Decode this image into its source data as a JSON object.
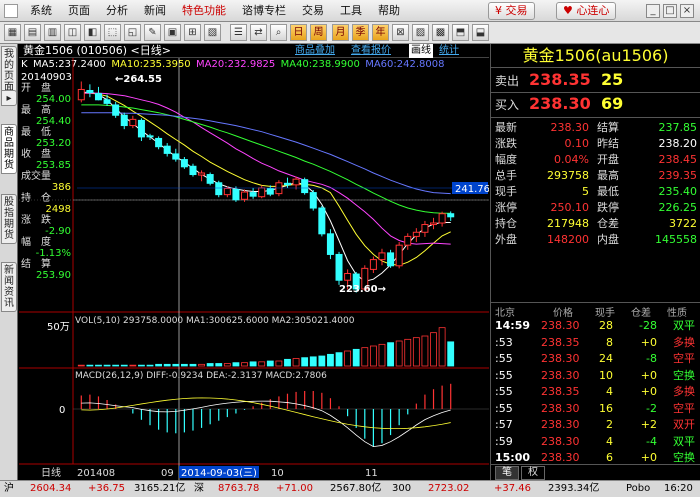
{
  "menu": {
    "items": [
      "系统",
      "页面",
      "分析",
      "新闻",
      "特色功能",
      "谘博专栏",
      "交易",
      "工具",
      "帮助"
    ],
    "active_index": 4,
    "trade_label": "交易",
    "connect_label": "心连心"
  },
  "toolbar": {
    "buttons": [
      "日",
      "周",
      "月",
      "季",
      "年"
    ]
  },
  "left_tabs": [
    "我的页面",
    "商品期货",
    "股指期货",
    "新闻资讯"
  ],
  "chart": {
    "title": "黄金1506 (010506) <日线>",
    "buttons": [
      "商品叠加",
      "查看报价",
      "画线",
      "统计"
    ],
    "ma_prefix": "K",
    "ma": [
      {
        "label": "MA5:237.2400",
        "color": "#ffffff"
      },
      {
        "label": "MA10:235.3950",
        "color": "#ffff33"
      },
      {
        "label": "MA20:232.9825",
        "color": "#ff44ff"
      },
      {
        "label": "MA40:238.9900",
        "color": "#33ff33"
      },
      {
        "label": "MA60:242.8008",
        "color": "#6677ff"
      }
    ],
    "info": {
      "date": "20140903",
      "open_label": "开　盘",
      "open": "254.00",
      "high_label": "最　高",
      "high": "254.40",
      "low_label": "最　低",
      "low": "253.20",
      "close_label": "收　盘",
      "close": "253.85",
      "volume_label": "成交量",
      "volume": "386",
      "oi_label": "持　仓",
      "oi": "2498",
      "chg_label": "涨　跌",
      "chg": "-2.90",
      "pct_label": "幅　度",
      "pct": "-1.13%",
      "settle_label": "结　算",
      "settle": "253.90"
    },
    "high_marker": "264.55",
    "low_marker": "223.60",
    "price_tag": "241.76",
    "volume_header": "VOL(5,10) 293758.0000 MA1:300625.6000 MA2:305021.4000",
    "volume_scale": "50万",
    "macd_header": "MACD(26,12,9) DIFF:-0.9234 DEA:-2.3137 MACD:2.7806",
    "macd_zero": "0",
    "x_labels": [
      "日线",
      "201408",
      "09",
      "2014-09-03(三)",
      "10",
      "11"
    ],
    "colors": {
      "up": "#ff3333",
      "down": "#33ffff"
    }
  },
  "chart_data": [
    {
      "type": "candlestick",
      "title": "黄金1506 (010506) <日线>",
      "series": [
        {
          "name": "MA5",
          "values": [
            262.3,
            262.6,
            262.0,
            261.0,
            259.3,
            257.7,
            256.4,
            255.0,
            253.8,
            252.6,
            251.2,
            250.0,
            248.9,
            247.7,
            246.5,
            245.6,
            244.7,
            244.1,
            243.7,
            243.4,
            243.2,
            243.2,
            243.4,
            243.9,
            244.4,
            245.0,
            244.5,
            243.1,
            240.7,
            237.5,
            233.7,
            229.8,
            227.1,
            225.8,
            226.2,
            227.4,
            229.0,
            231.0,
            233.1,
            234.8,
            236.1,
            236.9,
            237.2,
            237.2
          ]
        },
        {
          "name": "MA10",
          "values": [
            262.3,
            262.3,
            262.1,
            261.7,
            260.8,
            259.9,
            258.8,
            257.8,
            256.7,
            255.6,
            254.4,
            253.3,
            252.2,
            251.0,
            250.0,
            248.9,
            248.0,
            247.1,
            246.3,
            245.5,
            244.9,
            244.4,
            244.2,
            244.2,
            244.4,
            244.6,
            244.6,
            244.4,
            243.9,
            243.0,
            240.4,
            237.6,
            234.9,
            232.7,
            231.0,
            229.7,
            229.1,
            228.9,
            229.5,
            230.4,
            231.7,
            233.2,
            234.6,
            235.4
          ]
        },
        {
          "name": "MA20",
          "values": [
            262.3,
            262.3,
            262.3,
            262.2,
            262.0,
            261.8,
            261.4,
            261.0,
            260.6,
            260.1,
            259.4,
            258.6,
            257.6,
            256.7,
            255.6,
            254.6,
            253.6,
            252.6,
            251.5,
            250.6,
            249.6,
            248.7,
            248.0,
            247.2,
            246.6,
            246.0,
            245.4,
            245.0,
            244.6,
            244.0,
            243.0,
            241.9,
            240.6,
            239.3,
            237.8,
            236.1,
            234.6,
            233.7,
            233.2,
            233.0,
            233.1,
            233.2,
            233.1,
            233.0
          ]
        },
        {
          "name": "MA40",
          "values": [
            260.0,
            260.0,
            260.0,
            259.9,
            259.8,
            259.6,
            259.4,
            259.1,
            258.8,
            258.5,
            258.1,
            257.7,
            257.2,
            256.7,
            256.2,
            255.7,
            255.1,
            254.6,
            254.0,
            253.4,
            252.8,
            252.2,
            251.6,
            251.0,
            250.4,
            249.8,
            249.1,
            248.5,
            247.8,
            247.1,
            246.3,
            245.5,
            244.6,
            243.8,
            242.9,
            242.1,
            241.3,
            240.6,
            240.0,
            239.6,
            239.3,
            239.1,
            239.0,
            239.0
          ]
        },
        {
          "name": "MA60",
          "values": [
            258.5,
            258.5,
            258.5,
            258.5,
            258.5,
            258.4,
            258.4,
            258.3,
            258.2,
            258.1,
            258.0,
            257.8,
            257.6,
            257.4,
            257.2,
            256.9,
            256.6,
            256.3,
            256.0,
            255.6,
            255.2,
            254.8,
            254.3,
            253.8,
            253.3,
            252.8,
            252.2,
            251.6,
            251.0,
            250.4,
            249.7,
            249.0,
            248.3,
            247.6,
            246.8,
            246.1,
            245.4,
            244.8,
            244.2,
            243.7,
            243.3,
            243.0,
            242.9,
            242.8
          ]
        }
      ],
      "ohlc": [
        [
          261,
          264.55,
          260.5,
          263
        ],
        [
          262.8,
          264,
          261.5,
          262.4
        ],
        [
          262.2,
          263.5,
          260.9,
          261
        ],
        [
          261,
          262,
          259.8,
          260.3
        ],
        [
          260,
          260.6,
          257.5,
          258
        ],
        [
          258,
          258.5,
          255.3,
          256
        ],
        [
          256,
          257.9,
          255.5,
          257.2
        ],
        [
          257,
          257.4,
          253,
          253.8
        ],
        [
          254,
          254.4,
          253.2,
          253.85
        ],
        [
          253.5,
          253.9,
          251.4,
          251.9
        ],
        [
          252,
          252.6,
          250,
          250.6
        ],
        [
          250.5,
          251.5,
          249,
          249.5
        ],
        [
          249.4,
          249.9,
          247.6,
          248
        ],
        [
          248.1,
          248.6,
          246.1,
          246.5
        ],
        [
          246.4,
          247.3,
          245.2,
          246.8
        ],
        [
          246.5,
          246.9,
          244.4,
          244.8
        ],
        [
          244.9,
          245.3,
          242.1,
          242.6
        ],
        [
          242.6,
          244.2,
          242.1,
          243.8
        ],
        [
          243.6,
          244.2,
          241.2,
          241.6
        ],
        [
          241.7,
          243.6,
          241.2,
          243.1
        ],
        [
          243,
          243.9,
          241.8,
          242.3
        ],
        [
          242.2,
          244.4,
          241.9,
          243.9
        ],
        [
          243.8,
          244.4,
          242.3,
          242.7
        ],
        [
          242.8,
          245.4,
          242.3,
          244.9
        ],
        [
          244.8,
          245.9,
          243.9,
          244.5
        ],
        [
          244.5,
          246.1,
          243.6,
          245.6
        ],
        [
          245.5,
          245.9,
          242.6,
          243
        ],
        [
          243,
          243.5,
          239.5,
          240
        ],
        [
          240,
          240.4,
          234.5,
          235
        ],
        [
          235,
          235.9,
          230.1,
          231
        ],
        [
          231,
          231.5,
          225.1,
          226
        ],
        [
          226,
          228.1,
          224.2,
          227.3
        ],
        [
          227.2,
          227.6,
          223.6,
          224.3
        ],
        [
          224.3,
          228.9,
          223.9,
          228.3
        ],
        [
          228.1,
          230.6,
          227.4,
          230
        ],
        [
          230,
          232.1,
          228.9,
          231.3
        ],
        [
          231.3,
          231.9,
          228.4,
          228.8
        ],
        [
          228.8,
          233.4,
          228.3,
          232.8
        ],
        [
          232.8,
          235.1,
          231.9,
          234.5
        ],
        [
          234.5,
          236.1,
          233.4,
          235.3
        ],
        [
          235.3,
          237.5,
          234.4,
          236.8
        ],
        [
          236.8,
          238.1,
          235.9,
          237.1
        ],
        [
          237.1,
          239.3,
          236.4,
          238.9
        ],
        [
          238.9,
          239.35,
          237.5,
          238.3
        ]
      ]
    },
    {
      "type": "bar",
      "title": "VOL(5,10)",
      "series": [
        {
          "name": "VOL",
          "values": [
            1,
            1,
            1,
            1,
            1,
            1,
            1,
            1,
            1,
            2,
            2,
            2,
            2,
            2,
            2,
            3,
            3,
            3,
            4,
            4,
            5,
            5,
            6,
            6,
            8,
            9,
            10,
            11,
            12,
            14,
            16,
            18,
            20,
            22,
            24,
            26,
            28,
            30,
            32,
            34,
            36,
            40,
            46,
            29
          ]
        }
      ]
    },
    {
      "type": "bar",
      "title": "MACD(26,12,9)",
      "series": [
        {
          "name": "MACD",
          "values": [
            1.5,
            1.6,
            1.4,
            1.0,
            0.5,
            0.0,
            -0.5,
            -1.2,
            -1.8,
            -2.3,
            -2.6,
            -2.7,
            -2.6,
            -2.4,
            -2.1,
            -1.7,
            -1.3,
            -0.9,
            -0.5,
            -0.1,
            0.3,
            0.7,
            1.1,
            1.4,
            1.7,
            1.9,
            2.0,
            2.0,
            1.8,
            1.2,
            0.3,
            -0.8,
            -2.1,
            -3.3,
            -4.2,
            -3.8,
            -2.9,
            -1.8,
            -0.6,
            0.6,
            1.6,
            2.2,
            2.6,
            2.8
          ]
        }
      ]
    }
  ],
  "quote": {
    "title": "黄金1506(au1506)",
    "sell_label": "卖出",
    "sell_price": "238.35",
    "sell_vol": "25",
    "buy_label": "买入",
    "buy_price": "238.30",
    "buy_vol": "69",
    "stats": [
      {
        "l": "最新",
        "v": "238.30",
        "c": "#ff3333"
      },
      {
        "l": "结算",
        "v": "237.85",
        "c": "#33ff33"
      },
      {
        "l": "涨跌",
        "v": "0.10",
        "c": "#ff3333"
      },
      {
        "l": "昨结",
        "v": "238.20",
        "c": "#ffffff"
      },
      {
        "l": "幅度",
        "v": "0.04%",
        "c": "#ff3333"
      },
      {
        "l": "开盘",
        "v": "238.45",
        "c": "#ff3333"
      },
      {
        "l": "总手",
        "v": "293758",
        "c": "#ffff33"
      },
      {
        "l": "最高",
        "v": "239.35",
        "c": "#ff3333"
      },
      {
        "l": "现手",
        "v": "5",
        "c": "#ffff33"
      },
      {
        "l": "最低",
        "v": "235.40",
        "c": "#33ff33"
      },
      {
        "l": "涨停",
        "v": "250.10",
        "c": "#ff3333"
      },
      {
        "l": "跌停",
        "v": "226.25",
        "c": "#33ff33"
      },
      {
        "l": "持仓",
        "v": "217948",
        "c": "#ffff33"
      },
      {
        "l": "仓差",
        "v": "3722",
        "c": "#ffff33"
      },
      {
        "l": "外盘",
        "v": "148200",
        "c": "#ff3333"
      },
      {
        "l": "内盘",
        "v": "145558",
        "c": "#33ff33"
      }
    ],
    "trade_headers": [
      "北京",
      "价格",
      "现手",
      "仓差",
      "性质"
    ],
    "trades": [
      {
        "t": "14:59",
        "p": "238.30",
        "v": "28",
        "d": "-28",
        "n": "双平",
        "nc": "#33ff33"
      },
      {
        "t": ":53",
        "p": "238.35",
        "v": "8",
        "d": "+0",
        "n": "多换",
        "nc": "#ff3333"
      },
      {
        "t": ":55",
        "p": "238.30",
        "v": "24",
        "d": "-8",
        "n": "空平",
        "nc": "#ff3333"
      },
      {
        "t": ":55",
        "p": "238.30",
        "v": "10",
        "d": "+0",
        "n": "空换",
        "nc": "#33ff33"
      },
      {
        "t": ":55",
        "p": "238.35",
        "v": "4",
        "d": "+0",
        "n": "多换",
        "nc": "#ff3333"
      },
      {
        "t": ":55",
        "p": "238.30",
        "v": "16",
        "d": "-2",
        "n": "空平",
        "nc": "#ff3333"
      },
      {
        "t": ":57",
        "p": "238.30",
        "v": "2",
        "d": "+2",
        "n": "双开",
        "nc": "#ff3333"
      },
      {
        "t": ":59",
        "p": "238.30",
        "v": "4",
        "d": "-4",
        "n": "双平",
        "nc": "#33ff33"
      },
      {
        "t": "15:00",
        "p": "238.30",
        "v": "6",
        "d": "+0",
        "n": "空换",
        "nc": "#33ff33"
      }
    ],
    "tabs": [
      "笔",
      "权"
    ]
  },
  "statusbar": {
    "items": [
      {
        "t": "沪",
        "c": "#000000"
      },
      {
        "t": "2604.34",
        "c": "#cc0000"
      },
      {
        "t": "+36.75",
        "c": "#cc0000"
      },
      {
        "t": "3165.21亿",
        "c": "#000000"
      },
      {
        "t": "深",
        "c": "#000000"
      },
      {
        "t": "8763.78",
        "c": "#cc0000"
      },
      {
        "t": "+71.00",
        "c": "#cc0000"
      },
      {
        "t": "2567.80亿",
        "c": "#000000"
      },
      {
        "t": "300",
        "c": "#000000"
      },
      {
        "t": "2723.02",
        "c": "#cc0000"
      },
      {
        "t": "+37.46",
        "c": "#cc0000"
      },
      {
        "t": "2393.34亿",
        "c": "#000000"
      },
      {
        "t": "Pobo",
        "c": "#000000"
      },
      {
        "t": "16:20",
        "c": "#000000"
      }
    ]
  }
}
